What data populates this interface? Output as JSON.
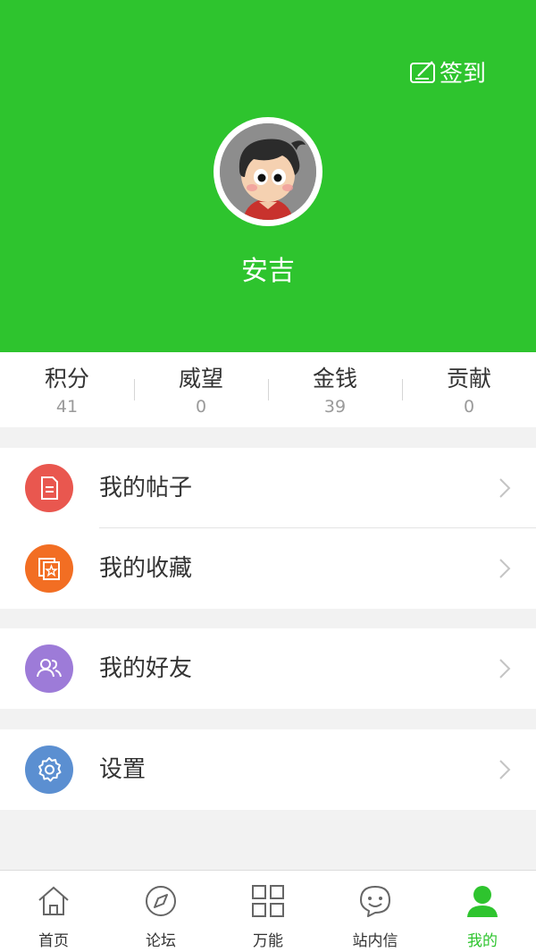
{
  "colors": {
    "header_bg": "#2ec42e",
    "accent": "#2ec42e",
    "posts_icon": "#e9574f",
    "favorites_icon": "#f26e23",
    "friends_icon": "#9d7bd8",
    "settings_icon": "#5b8fd1"
  },
  "header": {
    "signin_label": "签到",
    "signin_icon": "edit-box-icon",
    "username": "安吉"
  },
  "stats": [
    {
      "label": "积分",
      "value": "41"
    },
    {
      "label": "威望",
      "value": "0"
    },
    {
      "label": "金钱",
      "value": "39"
    },
    {
      "label": "贡献",
      "value": "0"
    }
  ],
  "menu": {
    "posts": {
      "label": "我的帖子",
      "icon": "document-icon"
    },
    "favorites": {
      "label": "我的收藏",
      "icon": "star-folder-icon"
    },
    "friends": {
      "label": "我的好友",
      "icon": "users-icon"
    },
    "settings": {
      "label": "设置",
      "icon": "gear-icon"
    }
  },
  "tabbar": [
    {
      "label": "首页",
      "icon": "home-icon",
      "active": false
    },
    {
      "label": "论坛",
      "icon": "compass-icon",
      "active": false
    },
    {
      "label": "万能",
      "icon": "grid-icon",
      "active": false
    },
    {
      "label": "站内信",
      "icon": "chat-smile-icon",
      "active": false
    },
    {
      "label": "我的",
      "icon": "person-icon",
      "active": true
    }
  ]
}
